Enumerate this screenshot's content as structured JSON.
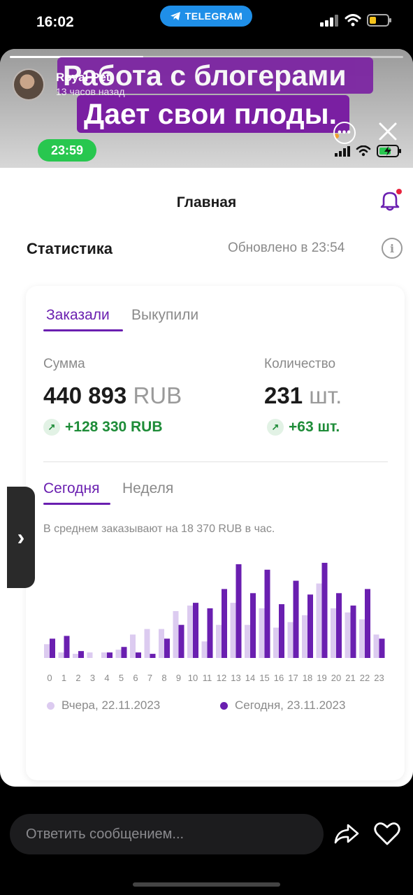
{
  "status_bar": {
    "time": "16:02",
    "source_app": "TELEGRAM"
  },
  "story": {
    "author": "Royal Pet",
    "posted_ago": "13 часов назад",
    "caption_line1": "Работа с блогерами",
    "caption_line2": "Дает свои плоды.",
    "progress": 0.34,
    "more_label": "•••",
    "reply_placeholder": "Ответить сообщением...",
    "side_handle_label": "›"
  },
  "inner": {
    "time": "23:59",
    "nav_title": "Главная",
    "section_title": "Статистика",
    "updated": "Обновлено в 23:54",
    "info_label": "i",
    "tabs": [
      {
        "label": "Заказали",
        "active": true
      },
      {
        "label": "Выкупили",
        "active": false
      }
    ],
    "sum": {
      "label": "Сумма",
      "value": "440 893",
      "unit": "RUB",
      "delta": "+128 330 RUB",
      "delta_icon": "↗"
    },
    "quantity": {
      "label": "Количество",
      "value": "231",
      "unit": "шт.",
      "delta": "+63 шт.",
      "delta_icon": "↗"
    },
    "period_tabs": [
      {
        "label": "Сегодня",
        "active": true
      },
      {
        "label": "Неделя",
        "active": false
      }
    ],
    "avg_note": "В среднем заказывают на 18 370 RUB в час.",
    "legend": [
      {
        "label": "Вчера, 22.11.2023",
        "color": "#dccbf0"
      },
      {
        "label": "Сегодня, 23.11.2023",
        "color": "#6a1fb0"
      }
    ]
  },
  "colors": {
    "accent": "#6a1fb0",
    "accent_light": "#dccbf0",
    "caption_bg": "#7a1fa2",
    "positive": "#1e8c38"
  },
  "chart_data": {
    "type": "bar",
    "categories": [
      "0",
      "1",
      "2",
      "3",
      "4",
      "5",
      "6",
      "7",
      "8",
      "9",
      "10",
      "11",
      "12",
      "13",
      "14",
      "15",
      "16",
      "17",
      "18",
      "19",
      "20",
      "21",
      "22",
      "23"
    ],
    "series": [
      {
        "name": "Вчера, 22.11.2023",
        "values": [
          10,
          4,
          3,
          4,
          4,
          6,
          17,
          21,
          21,
          34,
          38,
          12,
          24,
          40,
          24,
          36,
          22,
          26,
          31,
          54,
          36,
          33,
          28,
          17
        ]
      },
      {
        "name": "Сегодня, 23.11.2023",
        "values": [
          14,
          16,
          5,
          0,
          4,
          8,
          4,
          3,
          14,
          24,
          40,
          36,
          50,
          68,
          47,
          64,
          39,
          56,
          46,
          69,
          47,
          38,
          50,
          14
        ]
      }
    ],
    "ylim": [
      0,
      72
    ],
    "xlabel": "",
    "ylabel": "",
    "grid": false,
    "legend_position": "bottom"
  }
}
